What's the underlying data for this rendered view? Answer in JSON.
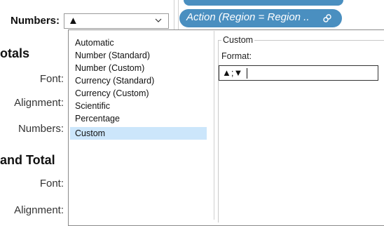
{
  "numbers_select": {
    "label": "Numbers:",
    "value": "▲"
  },
  "action_pill": {
    "text": "Action (Region = Region .."
  },
  "left_pane": {
    "totals_heading": "otals",
    "font_label": "Font:",
    "alignment_label": "Alignment:",
    "numbers_label": "Numbers:",
    "grand_total_heading": "and Total",
    "font_label_2": "Font:",
    "alignment_label_2": "Alignment:"
  },
  "format_list": {
    "items": [
      "Automatic",
      "Number (Standard)",
      "Number (Custom)",
      "Currency (Standard)",
      "Currency (Custom)",
      "Scientific",
      "Percentage",
      "Custom"
    ],
    "selected": "Custom"
  },
  "custom_panel": {
    "group_title": "Custom",
    "format_label": "Format:",
    "format_value": "▲;▼"
  },
  "colors": {
    "pill": "#4a8fc0",
    "selection": "#cce6fb"
  }
}
